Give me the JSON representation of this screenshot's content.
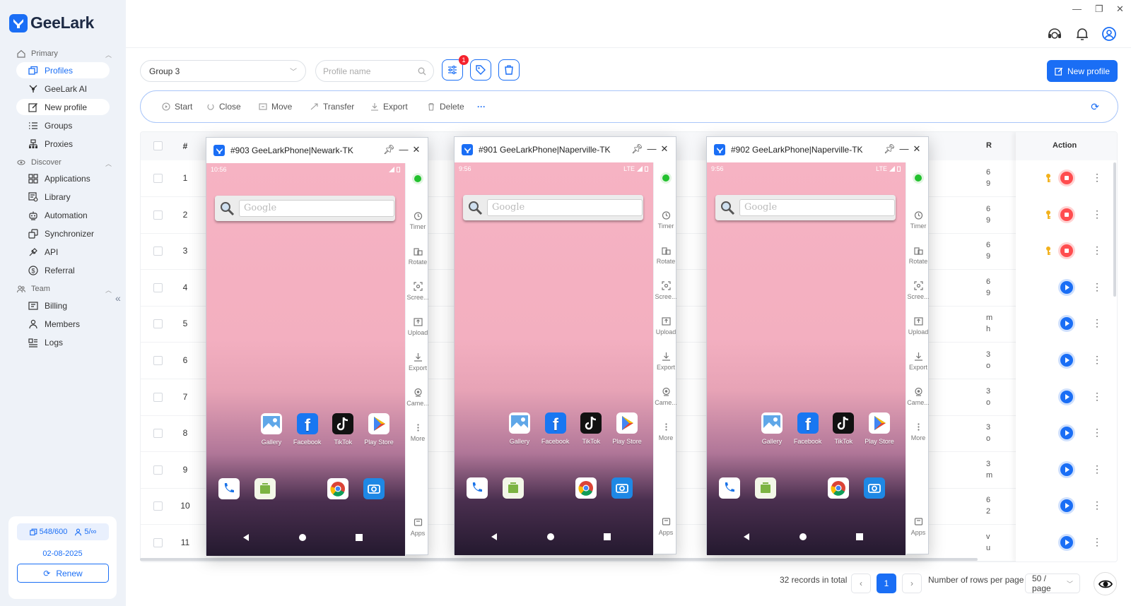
{
  "app": {
    "name": "GeeLark"
  },
  "sidebar": {
    "sections": [
      {
        "label": "Primary"
      },
      {
        "label": "Discover"
      },
      {
        "label": "Team"
      }
    ],
    "items": [
      {
        "label": "Profiles",
        "icon": "profiles-icon"
      },
      {
        "label": "GeeLark AI",
        "icon": "ai-icon"
      },
      {
        "label": "New profile",
        "icon": "edit-icon"
      },
      {
        "label": "Groups",
        "icon": "list-icon"
      },
      {
        "label": "Proxies",
        "icon": "proxy-icon"
      },
      {
        "label": "Applications",
        "icon": "apps-icon"
      },
      {
        "label": "Library",
        "icon": "library-icon"
      },
      {
        "label": "Automation",
        "icon": "robot-icon"
      },
      {
        "label": "Synchronizer",
        "icon": "sync-icon"
      },
      {
        "label": "API",
        "icon": "api-icon"
      },
      {
        "label": "Referral",
        "icon": "dollar-icon"
      },
      {
        "label": "Billing",
        "icon": "billing-icon"
      },
      {
        "label": "Members",
        "icon": "user-icon"
      },
      {
        "label": "Logs",
        "icon": "logs-icon"
      }
    ],
    "plan": {
      "profiles": "548/600",
      "members": "5/∞",
      "date": "02-08-2025",
      "renew_label": "Renew"
    }
  },
  "header": {
    "group": "Group 3",
    "search_placeholder": "Profile name",
    "filter_badge": "1",
    "new_profile_label": "New profile"
  },
  "toolbar": {
    "start": "Start",
    "close": "Close",
    "move": "Move",
    "transfer": "Transfer",
    "export": "Export",
    "delete": "Delete",
    "more": "···"
  },
  "table": {
    "headers": {
      "num": "#",
      "r": "R",
      "action": "Action"
    },
    "rows": [
      {
        "n": "1",
        "r": "6\n9",
        "state": "running"
      },
      {
        "n": "2",
        "r": "6\n9",
        "state": "running"
      },
      {
        "n": "3",
        "r": "6\n9",
        "state": "running"
      },
      {
        "n": "4",
        "r": "6\n9",
        "state": "stopped"
      },
      {
        "n": "5",
        "r": "m\nh",
        "state": "stopped"
      },
      {
        "n": "6",
        "r": "3\no",
        "state": "stopped"
      },
      {
        "n": "7",
        "r": "3\no",
        "state": "stopped"
      },
      {
        "n": "8",
        "r": "3\no",
        "state": "stopped"
      },
      {
        "n": "9",
        "r": "3\nm",
        "state": "stopped"
      },
      {
        "n": "10",
        "r": "6\n2",
        "state": "stopped"
      },
      {
        "n": "11",
        "r": "v\nu",
        "state": "stopped"
      }
    ]
  },
  "pagination": {
    "total": "32 records in total",
    "current": "1",
    "rows_label": "Number of rows per page",
    "per_page": "50 / page"
  },
  "phones": [
    {
      "title": "#903 GeeLarkPhone|Newark-TK",
      "time": "10:56",
      "signal": ""
    },
    {
      "title": "#901 GeeLarkPhone|Naperville-TK",
      "time": "9:56",
      "signal": "LTE"
    },
    {
      "title": "#902 GeeLarkPhone|Naperville-TK",
      "time": "9:56",
      "signal": "LTE"
    }
  ],
  "phone_common": {
    "search_text": "Google",
    "apps": [
      "Gallery",
      "Facebook",
      "TikTok",
      "Play Store"
    ],
    "side_buttons": [
      "Timer",
      "Rotate",
      "Scree...",
      "Upload",
      "Export",
      "Came...",
      "More"
    ],
    "apps_button": "Apps"
  },
  "colors": {
    "accent": "#1a6ef5",
    "stop": "#ff4d4f",
    "online": "#22c12e"
  }
}
